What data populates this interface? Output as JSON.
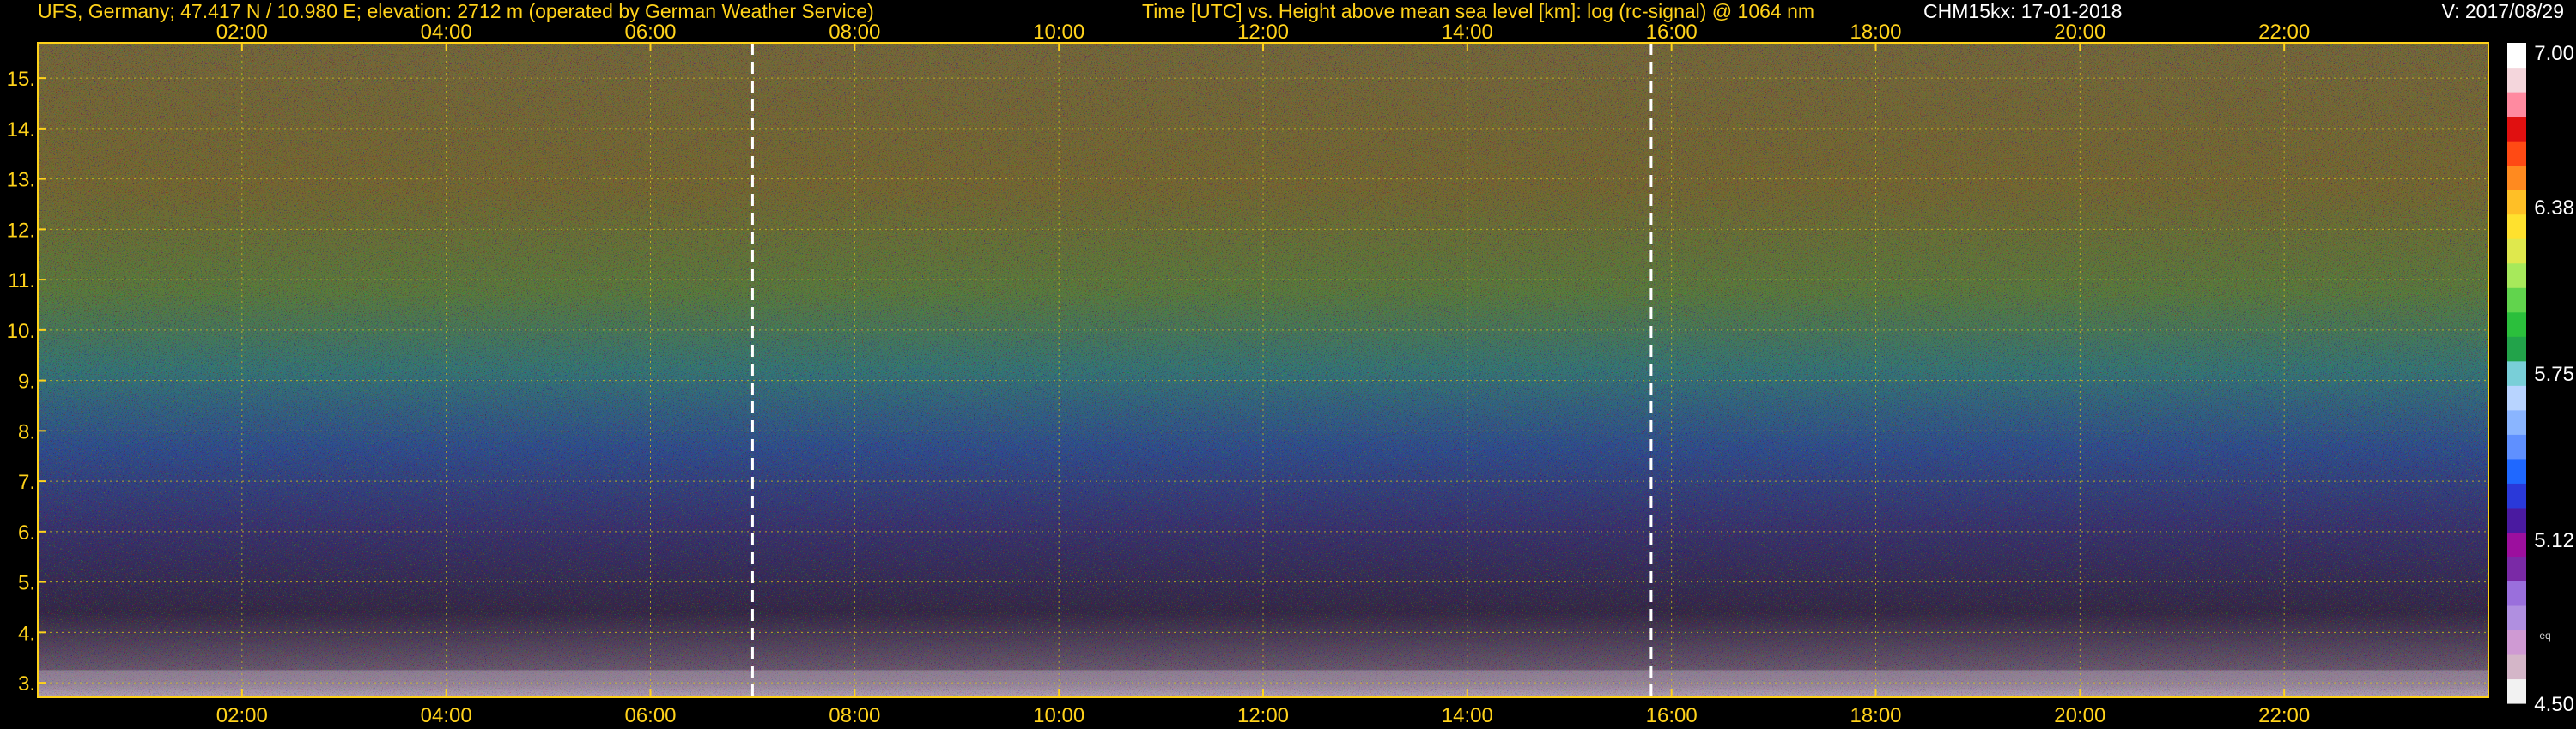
{
  "header": {
    "site": "UFS, Germany; 47.417 N / 10.980 E; elevation: 2712 m  (operated by German Weather Service)",
    "title": "Time [UTC] vs. Height above mean sea level [km]: log (rc-signal) @ 1064 nm",
    "instrument": "CHM15kx: 17-01-2018",
    "version": "V: 2017/08/29"
  },
  "chart_data": {
    "type": "heatmap",
    "title": "Time [UTC] vs. Height above mean sea level [km]: log (rc-signal) @ 1064 nm",
    "xlabel": "Time [UTC]",
    "ylabel": "Height above mean sea level [km]",
    "xlim": [
      0,
      24
    ],
    "ylim": [
      2.712,
      15.7
    ],
    "x_ticks": [
      2,
      4,
      6,
      8,
      10,
      12,
      14,
      16,
      18,
      20,
      22
    ],
    "x_tick_labels": [
      "02:00",
      "04:00",
      "06:00",
      "08:00",
      "10:00",
      "12:00",
      "14:00",
      "16:00",
      "18:00",
      "20:00",
      "22:00"
    ],
    "y_ticks": [
      3,
      4,
      5,
      6,
      7,
      8,
      9,
      10,
      11,
      12,
      13,
      14,
      15
    ],
    "y_tick_labels": [
      "3.",
      "4.",
      "5.",
      "6.",
      "7.",
      "8.",
      "9.",
      "10.",
      "11.",
      "12.",
      "13.",
      "14.",
      "15."
    ],
    "grid": true,
    "marker_lines_utc": [
      7.0,
      15.8
    ],
    "colorbar": {
      "min": 4.5,
      "max": 7.0,
      "tick_values": [
        4.5,
        5.12,
        5.75,
        6.38,
        7.0
      ],
      "tick_labels": [
        "4.50",
        "5.12",
        "5.75",
        "6.38",
        "7.00"
      ],
      "side_label": "eq"
    },
    "signal_gradient": [
      {
        "height_km": 3,
        "value": 4.7
      },
      {
        "height_km": 5,
        "value": 5.0
      },
      {
        "height_km": 7,
        "value": 5.35
      },
      {
        "height_km": 9,
        "value": 5.6
      },
      {
        "height_km": 11,
        "value": 5.85
      },
      {
        "height_km": 13,
        "value": 6.0
      },
      {
        "height_km": 15,
        "value": 6.1
      }
    ]
  },
  "colors": {
    "background": "#000000",
    "axis": "#ffd21a",
    "grid": "#d6c21c",
    "marker_line": "#ffffff",
    "header_primary": "#ffd21a",
    "header_secondary": "#ffffff",
    "colorbar_scale": [
      "#f2f2f2",
      "#d4b6c8",
      "#cf9ad3",
      "#b08fe0",
      "#9a6fdc",
      "#7a2aa6",
      "#9c0f9e",
      "#4a1aa0",
      "#2a39d9",
      "#1f68ff",
      "#5f90ff",
      "#8ab5ff",
      "#b8d4ff",
      "#79cfd8",
      "#22a34a",
      "#2bbf3c",
      "#61d44d",
      "#a7e95b",
      "#dfe84d",
      "#ffe12e",
      "#ffbf26",
      "#ff8a1f",
      "#ff4a14",
      "#e01010",
      "#ff8aa0",
      "#f4d6dc",
      "#ffffff"
    ]
  }
}
